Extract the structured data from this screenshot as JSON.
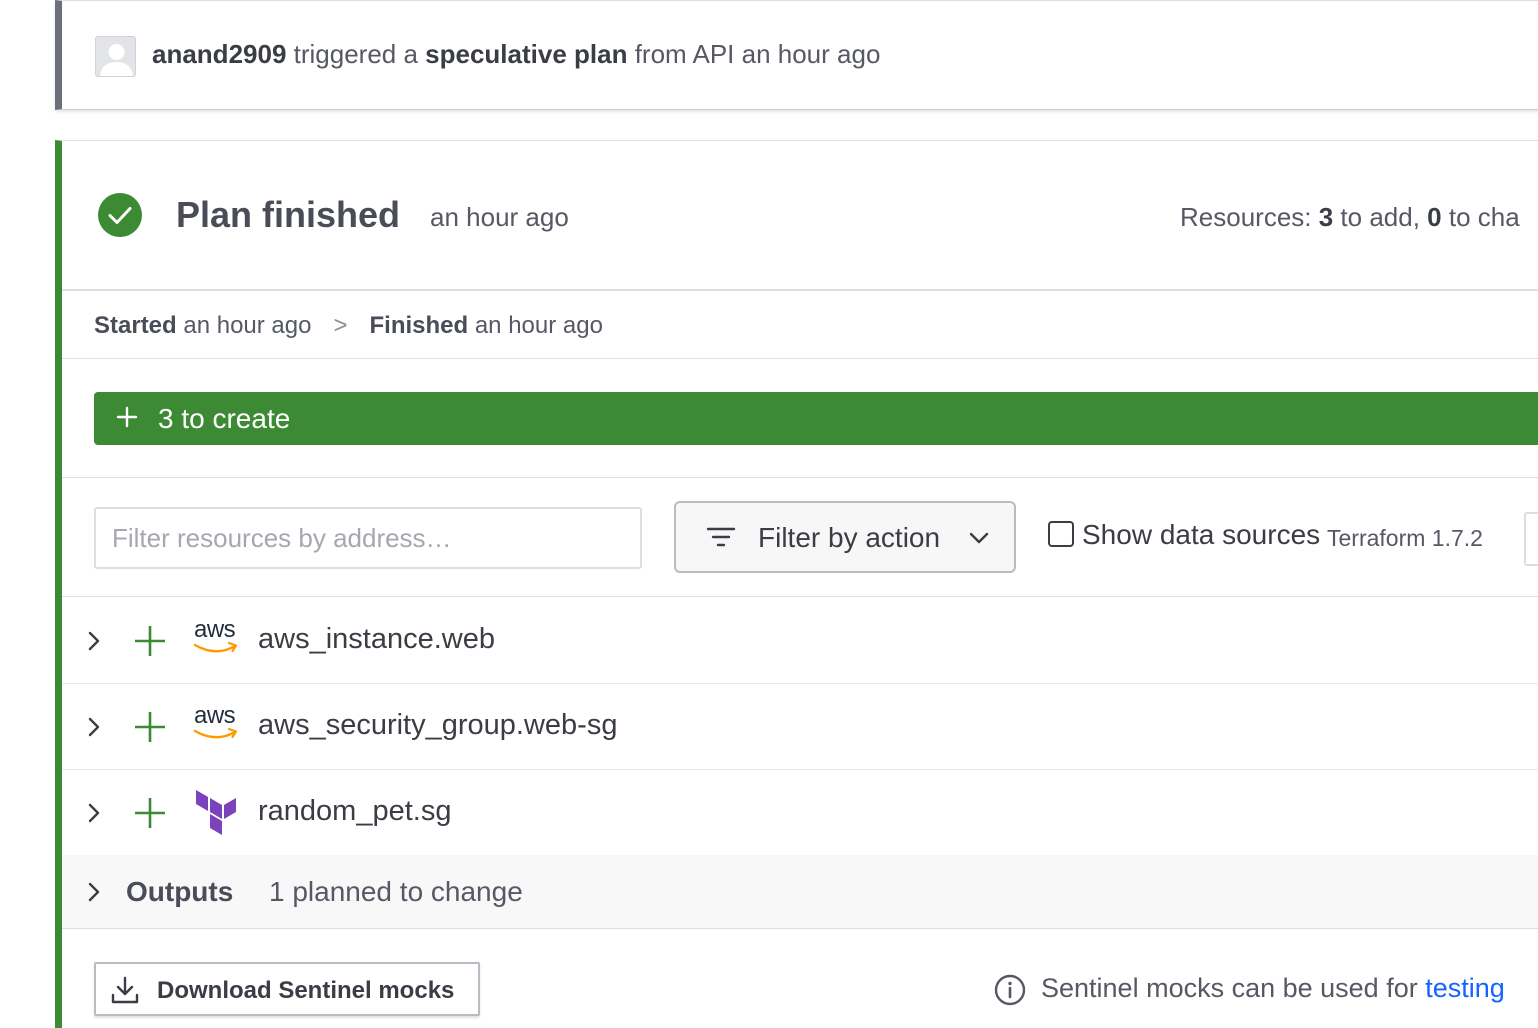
{
  "trigger": {
    "user": "anand2909",
    "verb": " triggered a ",
    "run_type": "speculative plan",
    "suffix": " from API an hour ago"
  },
  "plan": {
    "status": "Plan finished",
    "time": "an hour ago",
    "resources_prefix": "Resources: ",
    "add_count": "3",
    "add_text": " to add, ",
    "change_count": "0",
    "change_text": " to cha"
  },
  "timeline": {
    "started_label": "Started",
    "started_time": " an hour ago",
    "separator": ">",
    "finished_label": "Finished",
    "finished_time": " an hour ago"
  },
  "create_banner": {
    "label": "3 to create"
  },
  "filters": {
    "address_placeholder": "Filter resources by address…",
    "action_label": "Filter by action",
    "show_data_sources": "Show data sources",
    "terraform_version": "Terraform 1.7.2"
  },
  "resources": [
    {
      "address": "aws_instance.web",
      "provider": "aws"
    },
    {
      "address": "aws_security_group.web-sg",
      "provider": "aws"
    },
    {
      "address": "random_pet.sg",
      "provider": "terraform"
    }
  ],
  "outputs": {
    "label": "Outputs",
    "count_text": "1 planned to change"
  },
  "sentinel": {
    "download_label": "Download Sentinel mocks",
    "note_text": "Sentinel mocks can be used for ",
    "note_link": "testing"
  },
  "colors": {
    "success": "#3c8a34",
    "link": "#1563ff",
    "aws_orange": "#ff9900",
    "terraform_purple": "#7b42bc"
  }
}
